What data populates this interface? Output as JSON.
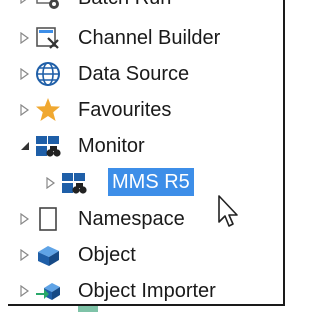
{
  "tree": {
    "items": [
      {
        "label": "Batch Run",
        "icon": "gear-icon",
        "expander": "collapsed"
      },
      {
        "label": "Channel Builder",
        "icon": "channel-builder-icon",
        "expander": "collapsed"
      },
      {
        "label": "Data Source",
        "icon": "globe-icon",
        "expander": "collapsed"
      },
      {
        "label": "Favourites",
        "icon": "star-icon",
        "expander": "collapsed"
      },
      {
        "label": "Monitor",
        "icon": "monitor-binoculars-icon",
        "expander": "expanded"
      },
      {
        "label": "MMS R5",
        "icon": "monitor-binoculars-icon",
        "expander": "collapsed",
        "selected": true,
        "level": 2
      },
      {
        "label": "Namespace",
        "icon": "namespace-icon",
        "expander": "collapsed"
      },
      {
        "label": "Object",
        "icon": "object-cube-icon",
        "expander": "collapsed"
      },
      {
        "label": "Object Importer",
        "icon": "object-importer-icon",
        "expander": "collapsed"
      }
    ]
  },
  "colors": {
    "selection": "#3d8ee8",
    "star": "#f0a830",
    "blue": "#1f6fc2",
    "green": "#2aa86a"
  }
}
